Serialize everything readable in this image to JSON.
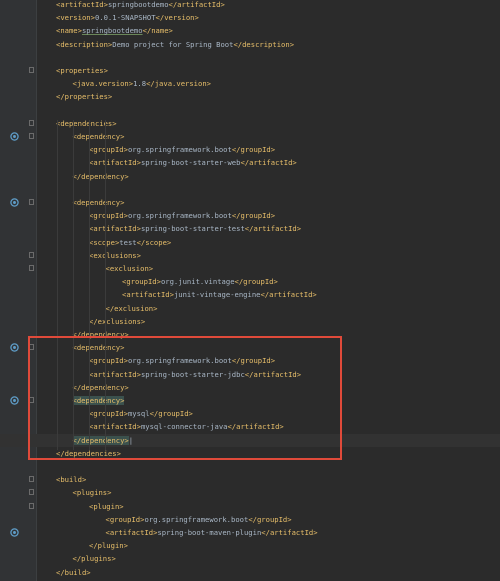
{
  "lines": [
    {
      "n": "",
      "parts": [
        [
          "t",
          "<artifactId>"
        ],
        [
          "v",
          "springbootdemo"
        ],
        [
          "t",
          "</artifactId>"
        ]
      ],
      "indent": 1
    },
    {
      "n": "",
      "parts": [
        [
          "t",
          "<version>"
        ],
        [
          "v",
          "0.0.1-SNAPSHOT"
        ],
        [
          "t",
          "</version>"
        ]
      ],
      "indent": 1
    },
    {
      "n": "",
      "parts": [
        [
          "t",
          "<name>"
        ],
        [
          "u",
          "springbootdemo"
        ],
        [
          "t",
          "</name>"
        ]
      ],
      "indent": 1
    },
    {
      "n": "",
      "parts": [
        [
          "t",
          "<description>"
        ],
        [
          "v",
          "Demo project for Spring Boot"
        ],
        [
          "t",
          "</description>"
        ]
      ],
      "indent": 1
    },
    {
      "n": "",
      "parts": [],
      "indent": 0
    },
    {
      "n": "",
      "parts": [
        [
          "t",
          "<properties>"
        ]
      ],
      "indent": 1
    },
    {
      "n": "",
      "parts": [
        [
          "t",
          "<java.version>"
        ],
        [
          "v",
          "1.8"
        ],
        [
          "t",
          "</java.version>"
        ]
      ],
      "indent": 2
    },
    {
      "n": "",
      "parts": [
        [
          "t",
          "</properties>"
        ]
      ],
      "indent": 1
    },
    {
      "n": "",
      "parts": [],
      "indent": 0
    },
    {
      "n": "",
      "parts": [
        [
          "t",
          "<dependencies>"
        ]
      ],
      "indent": 1
    },
    {
      "n": "",
      "parts": [
        [
          "t",
          "<dependency>"
        ]
      ],
      "indent": 2,
      "mark": true
    },
    {
      "n": "",
      "parts": [
        [
          "t",
          "<groupId>"
        ],
        [
          "v",
          "org.springframework.boot"
        ],
        [
          "t",
          "</groupId>"
        ]
      ],
      "indent": 3
    },
    {
      "n": "",
      "parts": [
        [
          "t",
          "<artifactId>"
        ],
        [
          "v",
          "spring-boot-starter-web"
        ],
        [
          "t",
          "</artifactId>"
        ]
      ],
      "indent": 3
    },
    {
      "n": "",
      "parts": [
        [
          "t",
          "</dependency>"
        ]
      ],
      "indent": 2
    },
    {
      "n": "",
      "parts": [],
      "indent": 0
    },
    {
      "n": "",
      "parts": [
        [
          "t",
          "<dependency>"
        ]
      ],
      "indent": 2,
      "mark": true
    },
    {
      "n": "",
      "parts": [
        [
          "t",
          "<groupId>"
        ],
        [
          "v",
          "org.springframework.boot"
        ],
        [
          "t",
          "</groupId>"
        ]
      ],
      "indent": 3
    },
    {
      "n": "",
      "parts": [
        [
          "t",
          "<artifactId>"
        ],
        [
          "v",
          "spring-boot-starter-test"
        ],
        [
          "t",
          "</artifactId>"
        ]
      ],
      "indent": 3
    },
    {
      "n": "",
      "parts": [
        [
          "t",
          "<scope>"
        ],
        [
          "v",
          "test"
        ],
        [
          "t",
          "</scope>"
        ]
      ],
      "indent": 3
    },
    {
      "n": "",
      "parts": [
        [
          "t",
          "<exclusions>"
        ]
      ],
      "indent": 3
    },
    {
      "n": "",
      "parts": [
        [
          "t",
          "<exclusion>"
        ]
      ],
      "indent": 4
    },
    {
      "n": "",
      "parts": [
        [
          "t",
          "<groupId>"
        ],
        [
          "v",
          "org.junit.vintage"
        ],
        [
          "t",
          "</groupId>"
        ]
      ],
      "indent": 5
    },
    {
      "n": "",
      "parts": [
        [
          "t",
          "<artifactId>"
        ],
        [
          "v",
          "junit-vintage-engine"
        ],
        [
          "t",
          "</artifactId>"
        ]
      ],
      "indent": 5
    },
    {
      "n": "",
      "parts": [
        [
          "t",
          "</exclusion>"
        ]
      ],
      "indent": 4
    },
    {
      "n": "",
      "parts": [
        [
          "t",
          "</exclusions>"
        ]
      ],
      "indent": 3
    },
    {
      "n": "",
      "parts": [
        [
          "t",
          "</dependency>"
        ]
      ],
      "indent": 2
    },
    {
      "n": "",
      "parts": [
        [
          "t",
          "<dependency>"
        ]
      ],
      "indent": 2,
      "mark": true
    },
    {
      "n": "",
      "parts": [
        [
          "t",
          "<groupId>"
        ],
        [
          "v",
          "org.springframework.boot"
        ],
        [
          "t",
          "</groupId>"
        ]
      ],
      "indent": 3
    },
    {
      "n": "",
      "parts": [
        [
          "t",
          "<artifactId>"
        ],
        [
          "v",
          "spring-boot-starter-jdbc"
        ],
        [
          "t",
          "</artifactId>"
        ]
      ],
      "indent": 3
    },
    {
      "n": "",
      "parts": [
        [
          "t",
          "</dependency>"
        ]
      ],
      "indent": 2
    },
    {
      "n": "",
      "parts": [
        [
          "h",
          "<dependency>"
        ]
      ],
      "indent": 2,
      "mark": true
    },
    {
      "n": "",
      "parts": [
        [
          "t",
          "<groupId>"
        ],
        [
          "v",
          "mysql"
        ],
        [
          "t",
          "</groupId>"
        ]
      ],
      "indent": 3
    },
    {
      "n": "",
      "parts": [
        [
          "t",
          "<artifactId>"
        ],
        [
          "v",
          "mysql-connector-java"
        ],
        [
          "t",
          "</artifactId>"
        ]
      ],
      "indent": 3
    },
    {
      "n": "",
      "parts": [
        [
          "h",
          "</dependency>"
        ],
        [
          "v",
          "|"
        ]
      ],
      "indent": 2,
      "caret": true
    },
    {
      "n": "",
      "parts": [
        [
          "t",
          "</dependencies>"
        ]
      ],
      "indent": 1
    },
    {
      "n": "",
      "parts": [],
      "indent": 0
    },
    {
      "n": "",
      "parts": [
        [
          "t",
          "<build>"
        ]
      ],
      "indent": 1
    },
    {
      "n": "",
      "parts": [
        [
          "t",
          "<plugins>"
        ]
      ],
      "indent": 2
    },
    {
      "n": "",
      "parts": [
        [
          "t",
          "<plugin>"
        ]
      ],
      "indent": 3
    },
    {
      "n": "",
      "parts": [
        [
          "t",
          "<groupId>"
        ],
        [
          "v",
          "org.springframework.boot"
        ],
        [
          "t",
          "</groupId>"
        ]
      ],
      "indent": 4
    },
    {
      "n": "",
      "parts": [
        [
          "t",
          "<artifactId>"
        ],
        [
          "v",
          "spring-boot-maven-plugin"
        ],
        [
          "t",
          "</artifactId>"
        ]
      ],
      "indent": 4,
      "mark": true
    },
    {
      "n": "",
      "parts": [
        [
          "t",
          "</plugin>"
        ]
      ],
      "indent": 3
    },
    {
      "n": "",
      "parts": [
        [
          "t",
          "</plugins>"
        ]
      ],
      "indent": 2
    },
    {
      "n": "",
      "parts": [
        [
          "t",
          "</build>"
        ]
      ],
      "indent": 1
    }
  ],
  "colors": {
    "background": "#2b2b2b",
    "gutter": "#313335",
    "tag": "#e8bf6a",
    "text": "#a9b7c6",
    "selection_box": "#e04a3a",
    "match_highlight": "#3b514d",
    "run_marker": "#5f9ec9"
  },
  "icons": {
    "gutter_marker": "run-dependency-icon",
    "fold": "fold-marker-icon"
  }
}
